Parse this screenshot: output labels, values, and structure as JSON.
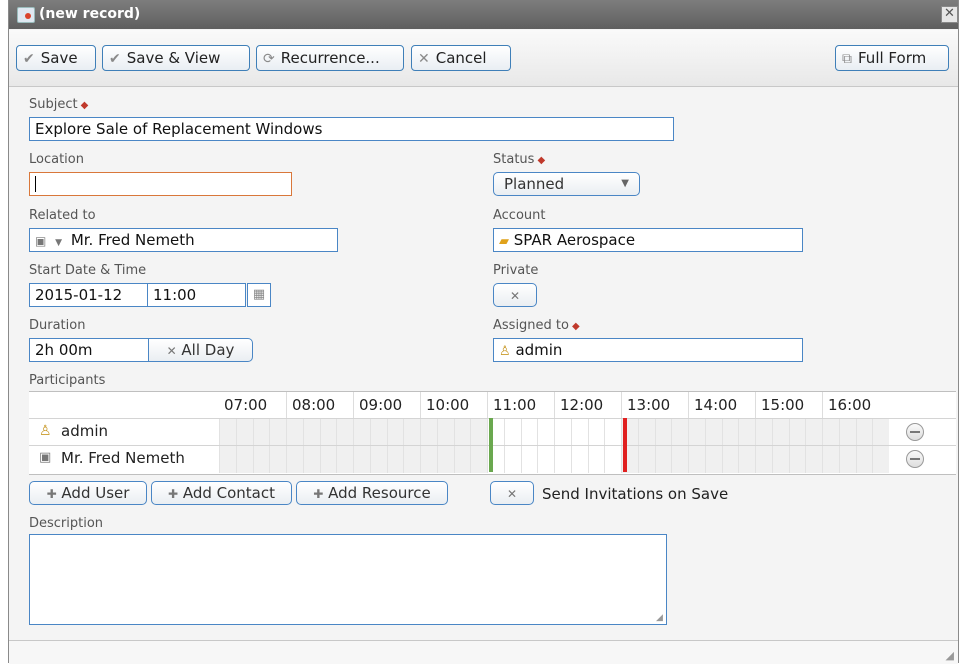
{
  "window": {
    "title": "(new record)",
    "close_glyph": "✕"
  },
  "toolbar": {
    "save": {
      "label": "Save",
      "icon": "check-icon"
    },
    "save_view": {
      "label": "Save & View",
      "icon": "check-icon"
    },
    "recurrence": {
      "label": "Recurrence...",
      "icon": "recurrence-icon"
    },
    "cancel": {
      "label": "Cancel",
      "icon": "x-icon"
    },
    "full_form": {
      "label": "Full Form",
      "icon": "full-form-icon"
    }
  },
  "form": {
    "subject": {
      "label": "Subject",
      "value": "Explore Sale of Replacement Windows"
    },
    "location": {
      "label": "Location",
      "value": ""
    },
    "status": {
      "label": "Status",
      "value": "Planned"
    },
    "related_to": {
      "label": "Related to",
      "value": "Mr. Fred Nemeth"
    },
    "account": {
      "label": "Account",
      "value": "SPAR Aerospace"
    },
    "start": {
      "label": "Start Date & Time",
      "date": "2015-01-12",
      "time": "11:00"
    },
    "private": {
      "label": "Private"
    },
    "duration": {
      "label": "Duration",
      "value": "2h 00m",
      "all_day_label": "All Day"
    },
    "assigned_to": {
      "label": "Assigned to",
      "value": "admin"
    },
    "participants_label": "Participants",
    "description": {
      "label": "Description",
      "value": ""
    }
  },
  "schedule": {
    "hours": [
      "07:00",
      "08:00",
      "09:00",
      "10:00",
      "11:00",
      "12:00",
      "13:00",
      "14:00",
      "15:00",
      "16:00"
    ],
    "participants": [
      {
        "name": "admin",
        "icon": "user-icon"
      },
      {
        "name": "Mr. Fred Nemeth",
        "icon": "contact-card-icon"
      }
    ],
    "slot_start_color": "#6aa84f",
    "slot_end_color": "#e02020"
  },
  "actions": {
    "add_user": "Add User",
    "add_contact": "Add Contact",
    "add_resource": "Add Resource",
    "send_invitations": "Send Invitations on Save"
  },
  "colors": {
    "accent_border": "#4a86c5",
    "required_marker": "#c0392b",
    "focus_border": "#d9773a"
  }
}
